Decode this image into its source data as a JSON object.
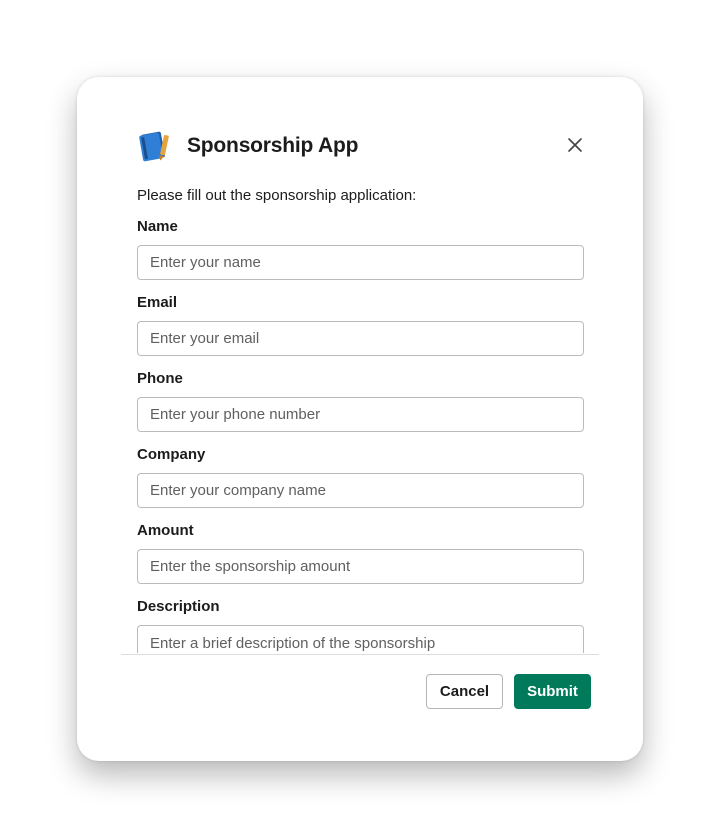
{
  "app": {
    "title": "Sponsorship App",
    "icon": "notebook-pencil-icon"
  },
  "form": {
    "intro": "Please fill out the sponsorship application:",
    "fields": [
      {
        "label": "Name",
        "placeholder": "Enter your name",
        "value": ""
      },
      {
        "label": "Email",
        "placeholder": "Enter your email",
        "value": ""
      },
      {
        "label": "Phone",
        "placeholder": "Enter your phone number",
        "value": ""
      },
      {
        "label": "Company",
        "placeholder": "Enter your company name",
        "value": ""
      },
      {
        "label": "Amount",
        "placeholder": "Enter the sponsorship amount",
        "value": ""
      },
      {
        "label": "Description",
        "placeholder": "Enter a brief description of the sponsorship",
        "value": ""
      }
    ]
  },
  "footer": {
    "cancel_label": "Cancel",
    "submit_label": "Submit"
  },
  "colors": {
    "submit_bg": "#007a5a",
    "text": "#1d1c1d",
    "input_border": "#bbbbbb"
  }
}
